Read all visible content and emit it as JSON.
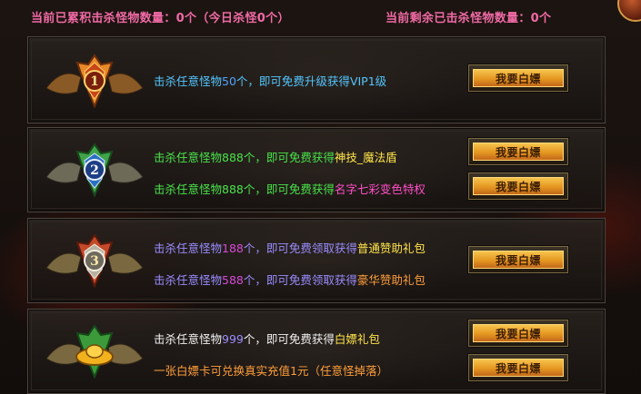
{
  "header": {
    "cumulative_kills": "当前已累积击杀怪物数量：0个（今日杀怪0个）",
    "remaining_kills": "当前剩余已击杀怪物数量：0个"
  },
  "button_label": "我要白嫖",
  "tiers": [
    {
      "rank": "1",
      "rows": [
        {
          "prefix": "击杀任意怪物",
          "count": "50",
          "middle": "个，即可免费升级获得",
          "reward": "VIP1级"
        }
      ]
    },
    {
      "rank": "2",
      "rows": [
        {
          "prefix": "击杀任意怪物",
          "count": "888",
          "middle": "个，即可免费获得",
          "reward": "神技_魔法盾"
        },
        {
          "prefix": "击杀任意怪物",
          "count": "888",
          "middle": "个，即可免费获得",
          "reward": "名字七彩变色特权"
        }
      ]
    },
    {
      "rank": "3",
      "rows": [
        {
          "prefix": "击杀任意怪物",
          "count": "188",
          "middle": "个，即可免费领取获得",
          "reward": "普通赞助礼包"
        },
        {
          "prefix": "击杀任意怪物",
          "count": "588",
          "middle": "个，即可免费领取获得",
          "reward": "豪华赞助礼包"
        }
      ]
    },
    {
      "rank": "",
      "rows": [
        {
          "prefix": "击杀任意怪物",
          "count": "999",
          "middle": "个，即可免费获得",
          "reward": "白嫖礼包"
        },
        {
          "prefix": "",
          "count": "",
          "middle": "",
          "reward": "一张白嫖卡可兑换真实充值1元（任意怪掉落）"
        }
      ]
    }
  ],
  "colors": {
    "header_text": "#f06aa5",
    "button_gold": "#e59721",
    "panel_border": "#4e4740"
  },
  "icons": {
    "tier1": "vip-rank-1-emblem-icon",
    "tier2": "vip-rank-2-emblem-icon",
    "tier3": "vip-rank-3-emblem-icon",
    "tier4": "gold-ingot-emblem-icon"
  }
}
